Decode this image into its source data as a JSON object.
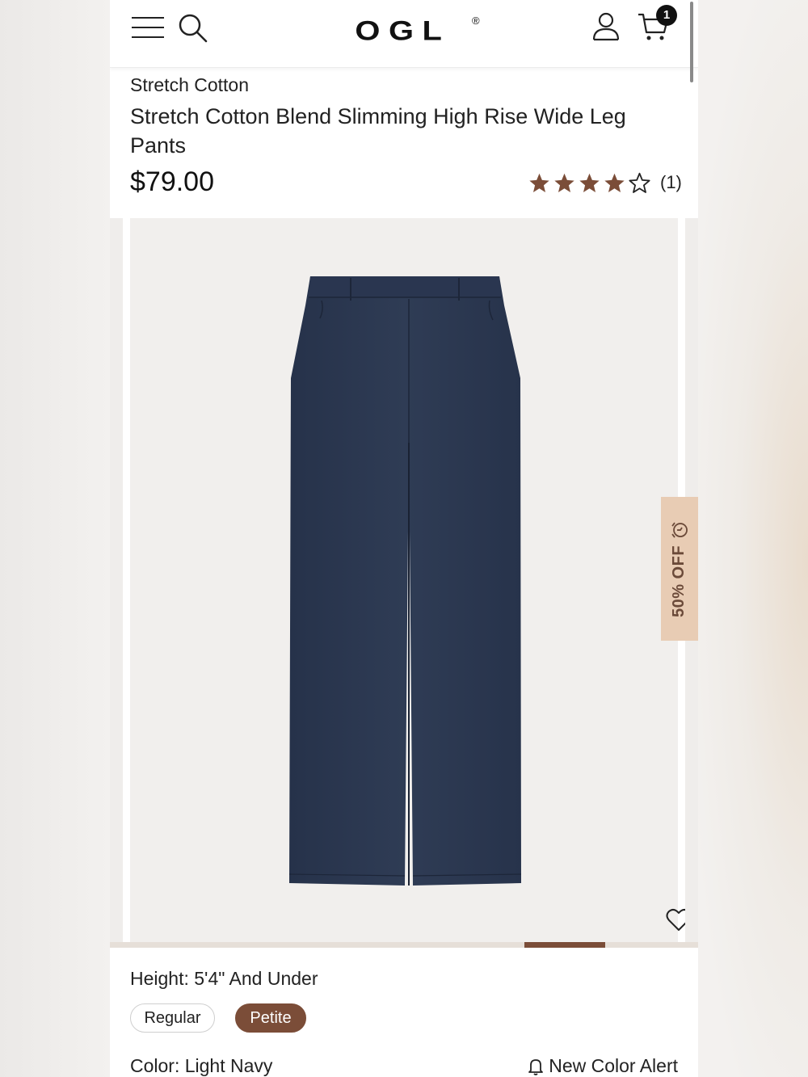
{
  "header": {
    "logo_text": "OGL",
    "logo_mark": "®",
    "cart_count": "1",
    "icons": [
      "hamburger-menu-icon",
      "search-icon",
      "account-icon",
      "cart-icon"
    ]
  },
  "product": {
    "collection": "Stretch Cotton",
    "title": "Stretch Cotton Blend Slimming High Rise Wide Leg Pants",
    "price": "$79.00",
    "rating_stars": 4,
    "rating_max": 5,
    "rating_count": "(1)"
  },
  "gallery": {
    "product_color": "#2f3c55",
    "current_slide_fraction_start": 0.705,
    "current_slide_fraction_end": 0.842,
    "discount_label": "50% OFF"
  },
  "options": {
    "height_label": "Height: 5'4\" And Under",
    "height_choices": [
      "Regular",
      "Petite"
    ],
    "height_selected": "Petite",
    "color_label": "Color: Light Navy",
    "color_alert": "New Color Alert"
  },
  "colors": {
    "accent": "#7b4d38",
    "star": "#7b4d38",
    "discount_bg": "#e8ccb4"
  }
}
